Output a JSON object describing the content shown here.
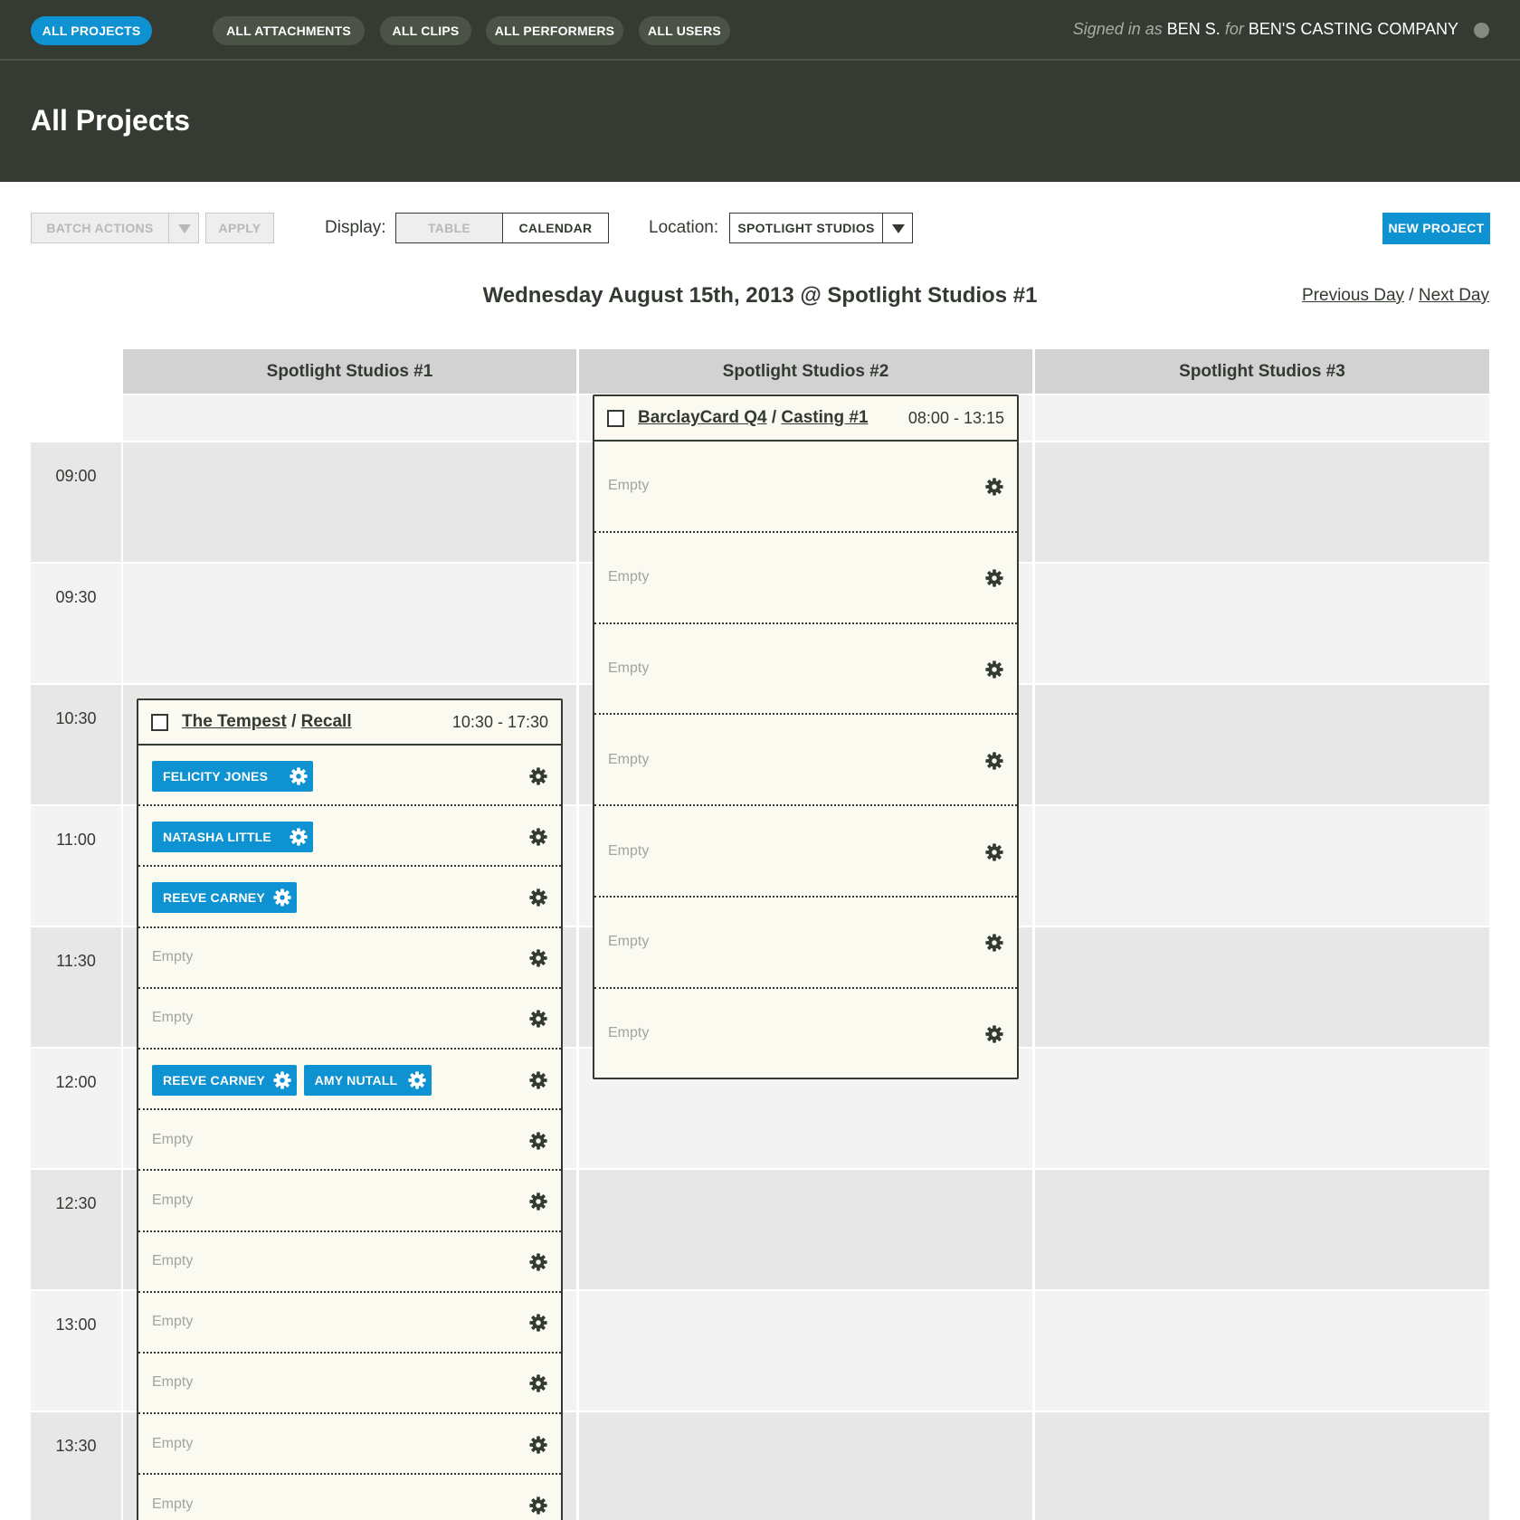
{
  "nav": {
    "tabs": [
      "ALL PROJECTS",
      "ALL ATTACHMENTS",
      "ALL CLIPS",
      "ALL PERFORMERS",
      "ALL USERS"
    ],
    "active_tab": "ALL PROJECTS",
    "signed_in_prefix": "Signed in as",
    "user": "BEN S.",
    "for_word": "for",
    "company": "BEN'S CASTING COMPANY"
  },
  "header": {
    "title": "All Projects"
  },
  "toolbar": {
    "batch_actions": "BATCH ACTIONS",
    "apply": "APPLY",
    "display_label": "Display:",
    "display_options": [
      "TABLE",
      "CALENDAR"
    ],
    "display_selected": "CALENDAR",
    "location_label": "Location:",
    "location_value": "SPOTLIGHT STUDIOS",
    "new_project": "NEW PROJECT"
  },
  "day": {
    "title": "Wednesday August 15th, 2013 @ Spotlight Studios #1",
    "previous": "Previous Day",
    "separator": "/",
    "next": "Next Day"
  },
  "calendar": {
    "rooms": [
      "Spotlight Studios #1",
      "Spotlight Studios #2",
      "Spotlight Studios #3"
    ],
    "times": [
      "09:00",
      "09:30",
      "10:30",
      "11:00",
      "11:30",
      "12:00",
      "12:30",
      "13:00",
      "13:30"
    ],
    "colors": {
      "accent": "#0e92d2",
      "dark": "#353b32",
      "event_bg": "#fbfaf0"
    }
  },
  "events": {
    "tempest": {
      "project": "The Tempest",
      "session": "Recall",
      "separator": "/",
      "time": "10:30 - 17:30",
      "slots": [
        {
          "performers": [
            "FELICITY JONES"
          ]
        },
        {
          "performers": [
            "NATASHA LITTLE"
          ]
        },
        {
          "performers": [
            "REEVE CARNEY"
          ]
        },
        {
          "empty": "Empty"
        },
        {
          "empty": "Empty"
        },
        {
          "performers": [
            "REEVE CARNEY",
            "AMY NUTALL"
          ]
        },
        {
          "empty": "Empty"
        },
        {
          "empty": "Empty"
        },
        {
          "empty": "Empty"
        },
        {
          "empty": "Empty"
        },
        {
          "empty": "Empty"
        },
        {
          "empty": "Empty"
        },
        {
          "empty": "Empty"
        }
      ]
    },
    "barclay": {
      "project": "BarclayCard Q4",
      "session": "Casting #1",
      "separator": "/",
      "time": "08:00 - 13:15",
      "slots": [
        {
          "empty": "Empty"
        },
        {
          "empty": "Empty"
        },
        {
          "empty": "Empty"
        },
        {
          "empty": "Empty"
        },
        {
          "empty": "Empty"
        },
        {
          "empty": "Empty"
        },
        {
          "empty": "Empty"
        }
      ]
    }
  }
}
